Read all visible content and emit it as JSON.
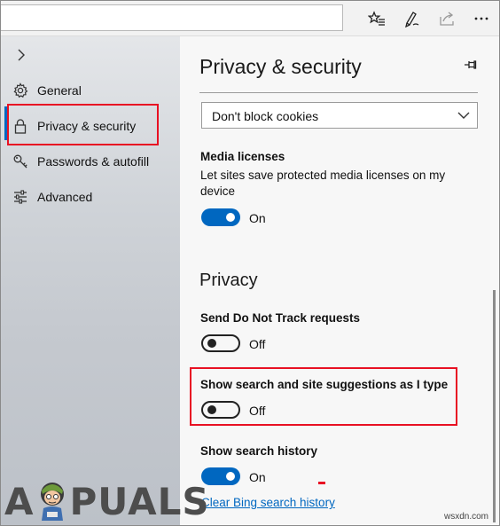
{
  "nav": {
    "items": [
      {
        "label": "General",
        "icon": "gear-icon"
      },
      {
        "label": "Privacy & security",
        "icon": "lock-icon",
        "active": true
      },
      {
        "label": "Passwords & autofill",
        "icon": "key-icon"
      },
      {
        "label": "Advanced",
        "icon": "sliders-icon"
      }
    ]
  },
  "pane": {
    "title": "Privacy & security",
    "cookies_value": "Don't block cookies",
    "media": {
      "label": "Media licenses",
      "desc": "Let sites save protected media licenses on my device",
      "state": "On"
    },
    "section_privacy": "Privacy",
    "dnt": {
      "label": "Send Do Not Track requests",
      "state": "Off"
    },
    "suggest": {
      "label": "Show search and site suggestions as I type",
      "state": "Off"
    },
    "history": {
      "label": "Show search history",
      "state": "On"
    },
    "clear_link": "Clear Bing search history"
  },
  "watermark": {
    "part1": "A",
    "part2": "PUALS"
  },
  "site_tag": "wsxdn.com",
  "colors": {
    "accent": "#0067c0",
    "highlight": "#e81123"
  }
}
